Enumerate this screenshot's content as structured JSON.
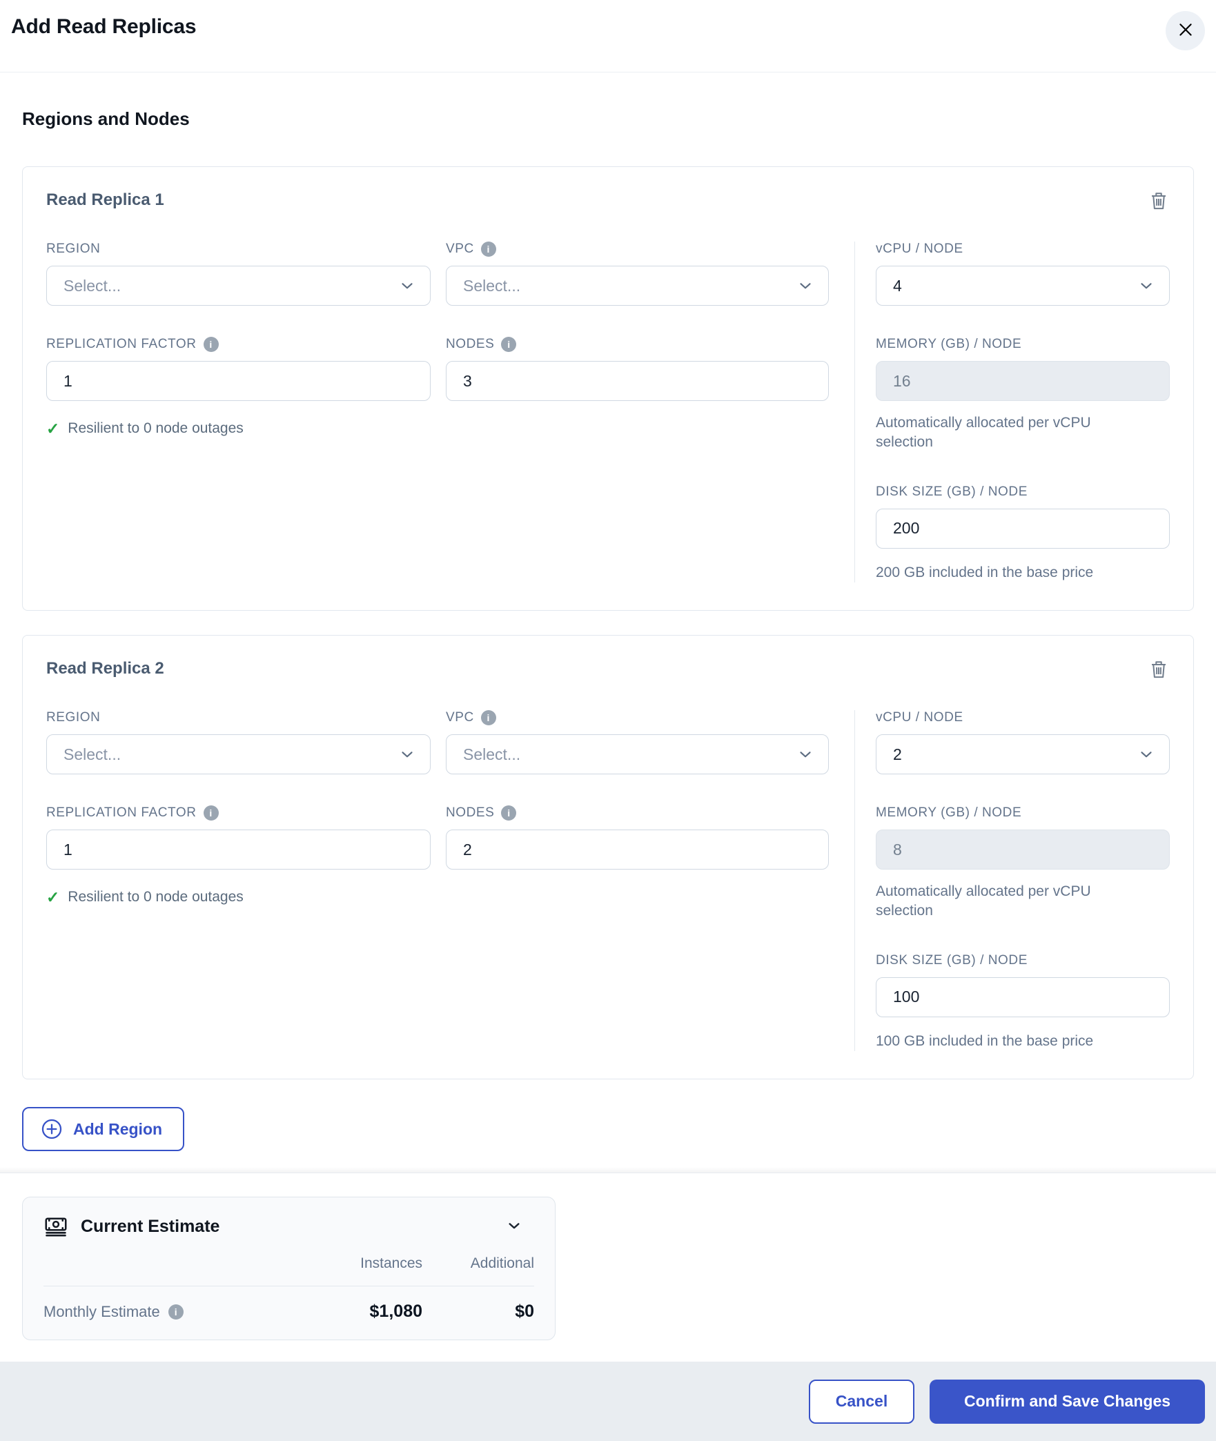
{
  "modal": {
    "title": "Add Read Replicas",
    "section_heading": "Regions and Nodes"
  },
  "replicas": [
    {
      "title": "Read Replica 1",
      "region": {
        "label": "REGION",
        "placeholder": "Select..."
      },
      "vpc": {
        "label": "VPC",
        "placeholder": "Select..."
      },
      "vcpu": {
        "label": "vCPU / NODE",
        "value": "4"
      },
      "replication_factor": {
        "label": "REPLICATION FACTOR",
        "value": "1"
      },
      "nodes": {
        "label": "NODES",
        "value": "3"
      },
      "memory": {
        "label": "MEMORY (GB) / NODE",
        "value": "16",
        "helper": "Automatically allocated per vCPU selection"
      },
      "resilience_note": "Resilient to 0 node outages",
      "disk": {
        "label": "DISK SIZE (GB) / NODE",
        "value": "200",
        "helper": "200 GB included in the base price"
      }
    },
    {
      "title": "Read Replica 2",
      "region": {
        "label": "REGION",
        "placeholder": "Select..."
      },
      "vpc": {
        "label": "VPC",
        "placeholder": "Select..."
      },
      "vcpu": {
        "label": "vCPU / NODE",
        "value": "2"
      },
      "replication_factor": {
        "label": "REPLICATION FACTOR",
        "value": "1"
      },
      "nodes": {
        "label": "NODES",
        "value": "2"
      },
      "memory": {
        "label": "MEMORY (GB) / NODE",
        "value": "8",
        "helper": "Automatically allocated per vCPU selection"
      },
      "resilience_note": "Resilient to 0 node outages",
      "disk": {
        "label": "DISK SIZE (GB) / NODE",
        "value": "100",
        "helper": "100 GB included in the base price"
      }
    }
  ],
  "add_region_label": "Add Region",
  "estimate": {
    "title": "Current Estimate",
    "col_instances": "Instances",
    "col_additional": "Additional",
    "row_label": "Monthly Estimate",
    "instances_value": "$1,080",
    "additional_value": "$0"
  },
  "footer": {
    "cancel_label": "Cancel",
    "confirm_label": "Confirm and Save Changes"
  },
  "colors": {
    "primary_blue": "#3752c7",
    "success_green": "#27a343"
  }
}
